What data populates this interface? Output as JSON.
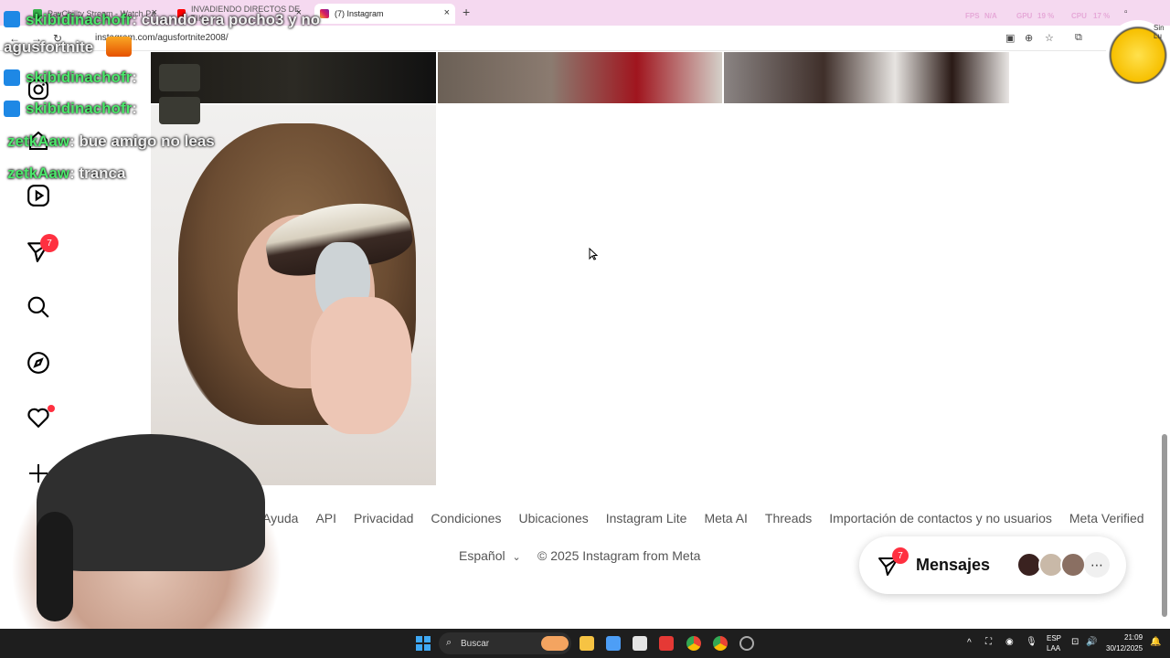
{
  "browser": {
    "tabs": [
      {
        "label": "PayChilltv Stream - Watch Pa",
        "icon": "green-square-icon",
        "active": false
      },
      {
        "label": "INVADIENDO DIRECTOS DE TIK",
        "icon": "youtube-icon",
        "active": false
      },
      {
        "label": "(7) Instagram",
        "icon": "instagram-icon",
        "active": true
      }
    ],
    "url": "instagram.com/agusfortnite2008/",
    "perf": {
      "fps_label": "FPS",
      "fps_value": "N/A",
      "gpu_label": "GPU",
      "gpu_value": "19 %",
      "cpu_label": "CPU",
      "cpu_value": "17 %"
    }
  },
  "instagram": {
    "sidebar": {
      "icons": [
        "instagram-logo-icon",
        "home-icon",
        "reels-icon",
        "messages-icon",
        "search-icon",
        "explore-icon",
        "notifications-icon",
        "create-icon",
        "dashboard-icon",
        "profile-avatar"
      ],
      "messages_badge": "7"
    },
    "footer": {
      "links": [
        "Ayuda",
        "API",
        "Privacidad",
        "Condiciones",
        "Ubicaciones",
        "Instagram Lite",
        "Meta AI",
        "Threads",
        "Importación de contactos y no usuarios",
        "Meta Verified"
      ],
      "language": "Español",
      "copyright": "© 2025 Instagram from Meta"
    },
    "messages_pill": {
      "label": "Mensajes",
      "badge": "7"
    }
  },
  "stream_overlay": {
    "chat": [
      {
        "user": "skibidinachofr",
        "text": ": cuando era pocho3 y no"
      },
      {
        "user": "",
        "text": "agusfortnite"
      },
      {
        "user": "skibidinachofr",
        "text": ":"
      },
      {
        "user": "skibidinachofr",
        "text": ":"
      },
      {
        "user": "zetkAaw",
        "text": ": bue amigo no leas"
      },
      {
        "user": "zetkAaw",
        "text": ": tranca"
      }
    ],
    "logo_text": "Sin Lu"
  },
  "taskbar": {
    "search_placeholder": "Buscar",
    "lang_top": "ESP",
    "lang_bottom": "LAA",
    "time": "21:09",
    "date": "30/12/2025"
  },
  "colors": {
    "accent_red": "#ff3040",
    "chat_green": "#4ce86b",
    "tabstrip_pink": "#f5d9f0"
  }
}
